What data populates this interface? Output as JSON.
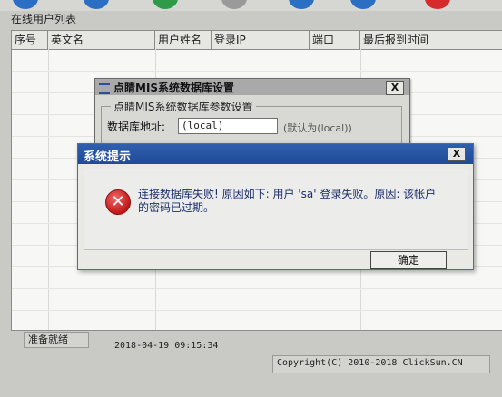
{
  "window": {
    "group_title": "在线用户列表"
  },
  "user_list": {
    "columns": [
      "序号",
      "英文名",
      "用户姓名",
      "登录IP",
      "端口",
      "最后报到时间"
    ]
  },
  "status_bar": {
    "status": "准备就绪",
    "datetime": "2018-04-19 09:15:34",
    "copyright": "Copyright(C) 2010-2018 ClickSun.CN"
  },
  "db_dialog": {
    "title": "点睛MIS系统数据库设置",
    "group_title": "点睛MIS系统数据库参数设置",
    "address_label": "数据库地址:",
    "address_value": "(local)",
    "address_hint": "(默认为(local))",
    "close_label": "X"
  },
  "sys_dialog": {
    "title": "系统提示",
    "message": "连接数据库失败! 原因如下: 用户 'sa' 登录失败。原因: 该帐户的密码已过期。",
    "ok_label": "确定",
    "close_label": "X"
  },
  "colors": {
    "titlebar_blue": "#2f5fae",
    "error_red": "#d32020",
    "message_text": "#1c2f6b"
  }
}
